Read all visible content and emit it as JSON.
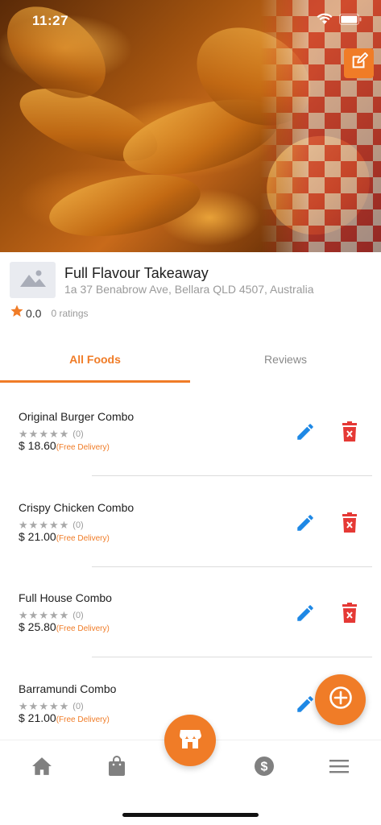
{
  "status_bar": {
    "time": "11:27"
  },
  "restaurant": {
    "name": "Full Flavour Takeaway",
    "address": "1a 37 Benabrow Ave, Bellara QLD 4507, Australia",
    "rating": "0.0",
    "ratings_count": "0 ratings"
  },
  "tabs": {
    "foods": "All Foods",
    "reviews": "Reviews"
  },
  "foods": [
    {
      "name": "Original Burger Combo",
      "rating_count": "(0)",
      "price": "$ 18.60",
      "delivery": "(Free Delivery)"
    },
    {
      "name": "Crispy Chicken Combo",
      "rating_count": "(0)",
      "price": "$ 21.00",
      "delivery": "(Free Delivery)"
    },
    {
      "name": "Full House Combo",
      "rating_count": "(0)",
      "price": "$ 25.80",
      "delivery": "(Free Delivery)"
    },
    {
      "name": "Barramundi Combo",
      "rating_count": "(0)",
      "price": "$ 21.00",
      "delivery": "(Free Delivery)"
    }
  ],
  "icons": {
    "edit_hero": "edit-square-icon",
    "edit_food": "pencil-icon",
    "delete_food": "trash-icon",
    "add": "plus-circle-icon",
    "store": "store-icon",
    "nav": [
      "home-icon",
      "shopping-bag-icon",
      "dollar-icon",
      "menu-icon"
    ]
  },
  "colors": {
    "accent": "#f07c27",
    "edit": "#1e88e5",
    "delete": "#e53935"
  }
}
